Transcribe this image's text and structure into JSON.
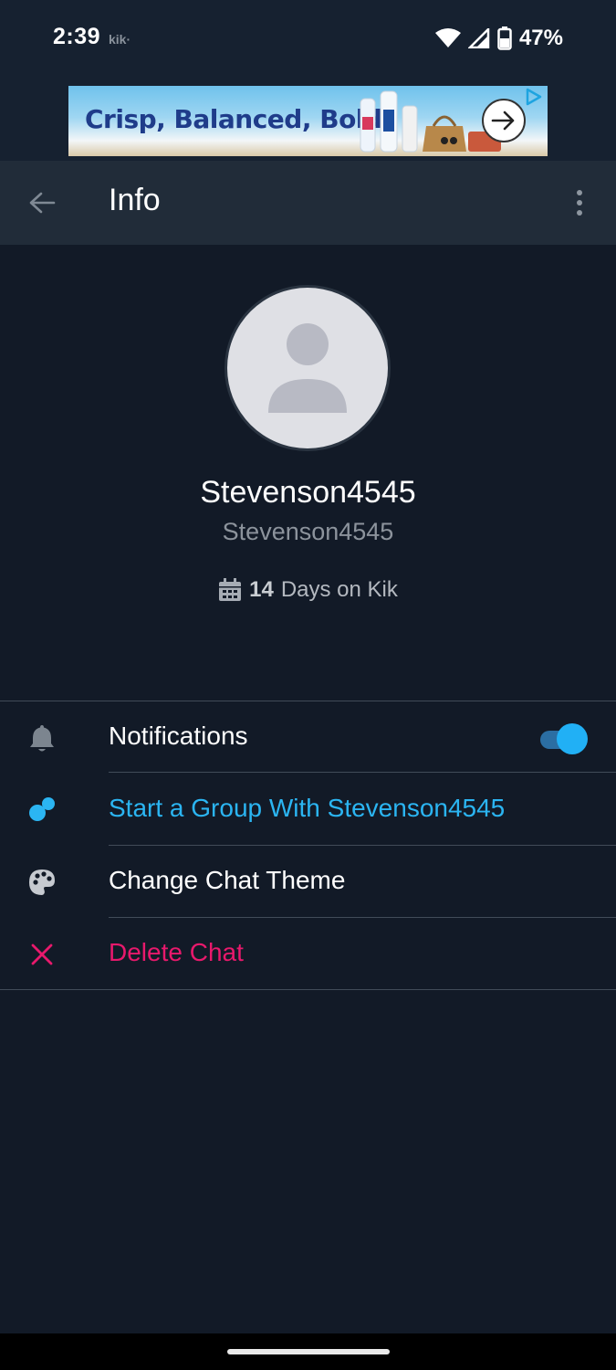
{
  "status_bar": {
    "time": "2:39",
    "app_badge": "kik·",
    "battery": "47%"
  },
  "ad": {
    "headline": "Crisp, Balanced, Bold"
  },
  "app_bar": {
    "title": "Info"
  },
  "profile": {
    "display_name": "Stevenson4545",
    "username": "Stevenson4545",
    "days_count": "14",
    "days_label": "Days on Kik"
  },
  "menu": {
    "notifications": {
      "label": "Notifications",
      "enabled": true
    },
    "start_group": {
      "label": "Start a Group With Stevenson4545"
    },
    "change_theme": {
      "label": "Change Chat Theme"
    },
    "delete_chat": {
      "label": "Delete Chat"
    }
  },
  "colors": {
    "background": "#121a27",
    "app_bar": "#212c39",
    "accent_blue": "#2bb5f2",
    "danger_pink": "#e8196c"
  }
}
